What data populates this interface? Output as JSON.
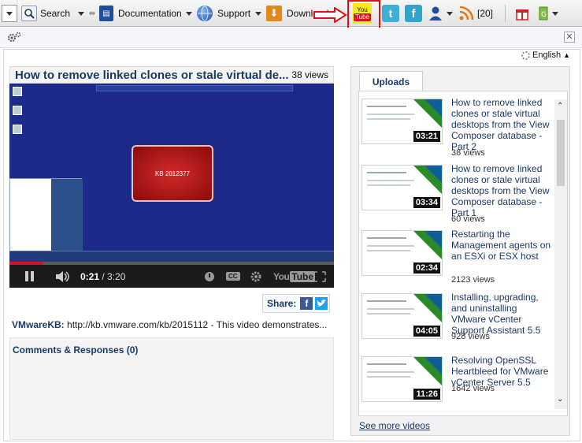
{
  "toolbar": {
    "search_label": "Search",
    "documentation_label": "Documentation",
    "support_label": "Support",
    "download_label": "Download",
    "youtube_label_top": "You",
    "youtube_label_bottom": "Tube",
    "rss_count": "[20]"
  },
  "language": "English",
  "video": {
    "title": "How to remove linked clones or stale virtual de...",
    "views": "38 views",
    "kb_label": "KB 2012377",
    "time_current": "0:21",
    "time_separator": " / ",
    "time_total": "3:20",
    "progress_fraction": 0.105
  },
  "share_label": "Share:",
  "description": {
    "source": "VMwareKB:",
    "text": " http://kb.vmware.com/kb/2015112 - This video demonstrates..."
  },
  "comments_label": "Comments & Responses (0)",
  "uploads_tab": "Uploads",
  "uploads": [
    {
      "title": "How to remove linked clones or stale virtual desktops from the View Composer database - Part 2",
      "views": "38 views",
      "duration": "03:21"
    },
    {
      "title": "How to remove linked clones or stale virtual desktops from the View Composer database - Part 1",
      "views": "60 views",
      "duration": "03:34"
    },
    {
      "title": "Restarting the Management agents on an ESXi or ESX host",
      "views": "2123 views",
      "duration": "02:34"
    },
    {
      "title": "Installing, upgrading, and uninstalling VMware vCenter Support Assistant 5.5",
      "views": "928 views",
      "duration": "04:05"
    },
    {
      "title": "Resolving OpenSSL Heartbleed for VMware vCenter Server 5.5",
      "views": "1642 views",
      "duration": "11:26"
    }
  ],
  "see_more": "See more videos",
  "colors": {
    "accent": "#1b3a66",
    "youtube_red": "#cc181e",
    "highlight_box": "#e01010"
  }
}
